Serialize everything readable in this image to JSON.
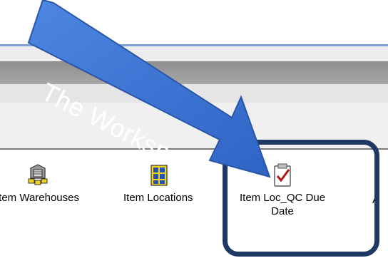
{
  "workspace": {
    "items": [
      {
        "label": "Item Warehouses",
        "icon": "warehouse-icon"
      },
      {
        "label": "Item Locations",
        "icon": "locations-icon"
      },
      {
        "label_line1": "Item Loc_QC Due",
        "label_line2": "Date",
        "icon": "checklist-icon"
      },
      {
        "label": "A",
        "icon": ""
      }
    ]
  },
  "callout": {
    "label": "The Workspace",
    "arrow_color": "#3d76d6",
    "frame_color": "#1f3864"
  }
}
